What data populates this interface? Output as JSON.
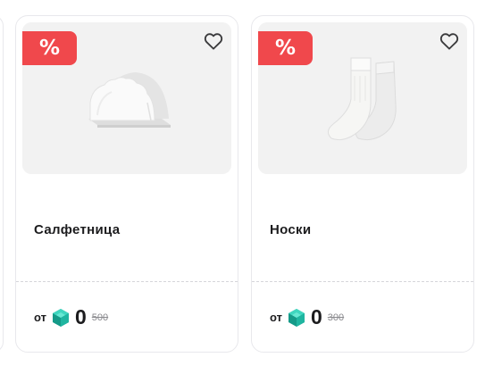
{
  "products": [
    {
      "badge": "%",
      "title": "Салфетница",
      "image_icon": "napkin-holder-image",
      "price_prefix": "от",
      "currency_icon": "gem-icon",
      "price": "0",
      "old_price": "500"
    },
    {
      "badge": "%",
      "title": "Носки",
      "image_icon": "socks-image",
      "price_prefix": "от",
      "currency_icon": "gem-icon",
      "price": "0",
      "old_price": "300"
    }
  ],
  "colors": {
    "badge": "#f0484c",
    "gem": "#1fb5a0",
    "image_bg": "#f2f2f2"
  }
}
